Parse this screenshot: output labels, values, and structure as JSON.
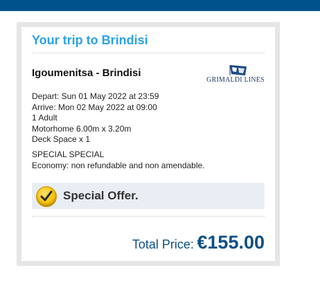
{
  "trip": {
    "title": "Your trip to Brindisi",
    "route": "Igoumenitsa - Brindisi",
    "operator": "GRIMALDI LINES",
    "depart": "Depart: Sun 01 May 2022 at 23:59",
    "arrive": "Arrive: Mon 02 May 2022 at 09:00",
    "passengers": "1 Adult",
    "vehicle": "Motorhome 6.00m x 3.20m",
    "deck": "Deck Space x 1",
    "fare_name": "SPECIAL SPECIAL",
    "fare_terms": "Economy: non refundable and non amendable."
  },
  "offer": {
    "icon": "checkmark-badge-icon",
    "label": "Special Offer."
  },
  "total": {
    "label": "Total Price:",
    "value": "€155.00"
  },
  "colors": {
    "topbar": "#00528a",
    "title": "#2aa2e6",
    "price": "#0d4f85",
    "offer_bg": "#e9eef5"
  }
}
